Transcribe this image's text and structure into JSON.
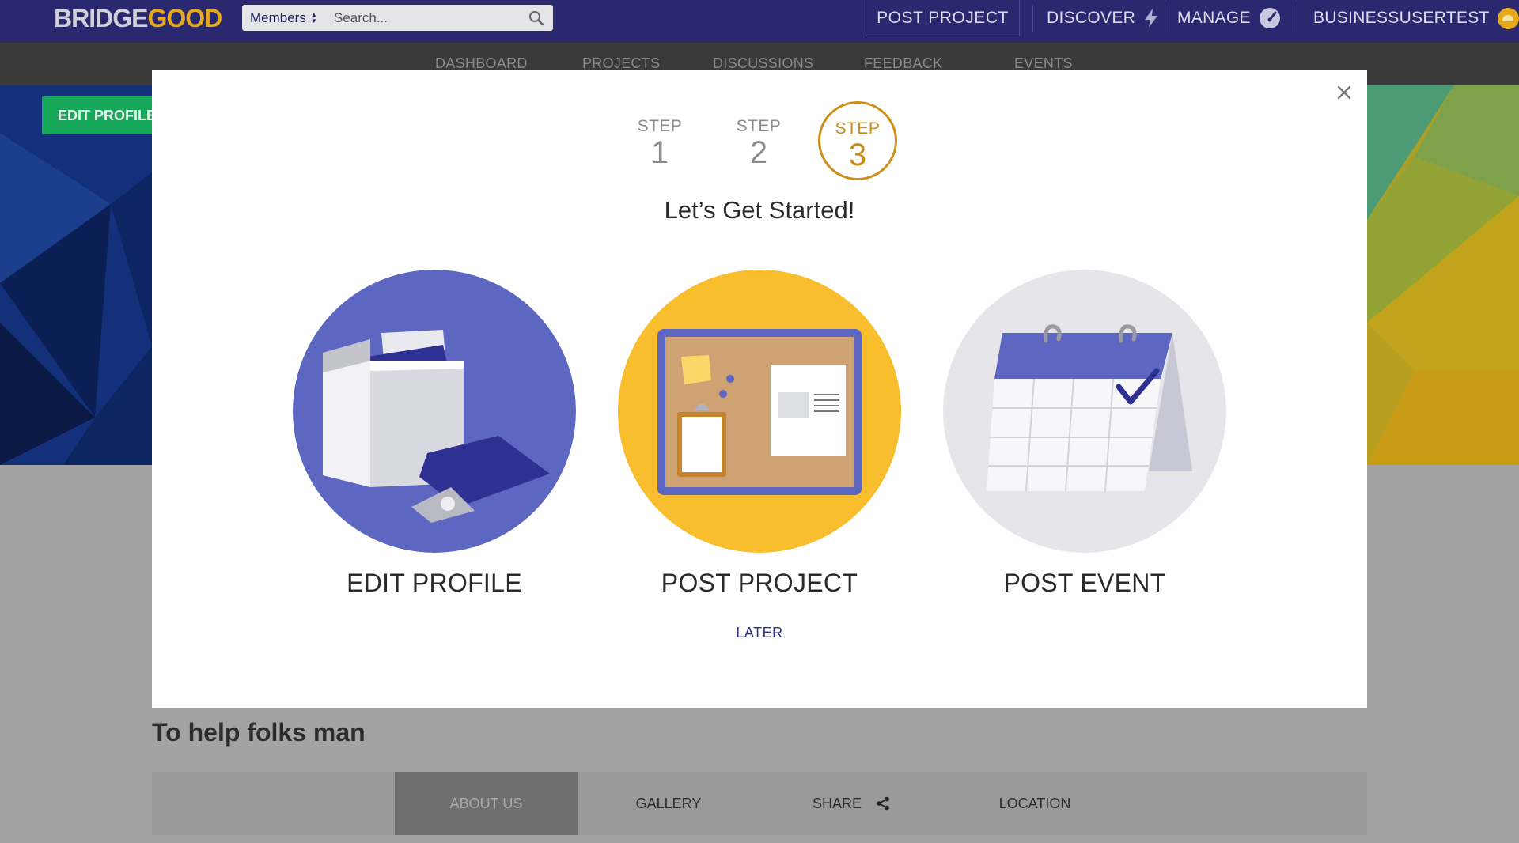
{
  "header": {
    "logo_part1": "BRIDGE",
    "logo_part2": "GOOD",
    "search_scope": "Members",
    "search_placeholder": "Search...",
    "post_project": "POST PROJECT",
    "discover": "DISCOVER",
    "manage": "MANAGE",
    "user": "BUSINESSUSERTEST"
  },
  "subnav": {
    "items": [
      "DASHBOARD",
      "PROJECTS",
      "DISCUSSIONS",
      "FEEDBACK",
      "EVENTS"
    ]
  },
  "background": {
    "edit_profile_button": "EDIT PROFILE",
    "heading": "To help folks man",
    "tabs": [
      "ABOUT US",
      "GALLERY",
      "SHARE",
      "LOCATION"
    ],
    "active_tab": "ABOUT US"
  },
  "modal": {
    "steps": [
      {
        "label": "STEP",
        "number": "1"
      },
      {
        "label": "STEP",
        "number": "2"
      },
      {
        "label": "STEP",
        "number": "3"
      }
    ],
    "active_step": 3,
    "title": "Let’s Get Started!",
    "options": [
      {
        "label": "EDIT PROFILE",
        "color": "#5d67c1"
      },
      {
        "label": "POST PROJECT",
        "color": "#f9be2e"
      },
      {
        "label": "POST EVENT",
        "color": "#e6e6ea"
      }
    ],
    "later": "LATER"
  },
  "colors": {
    "header_bg": "#2a286f",
    "accent_gold": "#e6a91b",
    "step_active": "#cf8f1a",
    "link_blue": "#2f3094",
    "edit_profile_green": "#17a85a"
  }
}
